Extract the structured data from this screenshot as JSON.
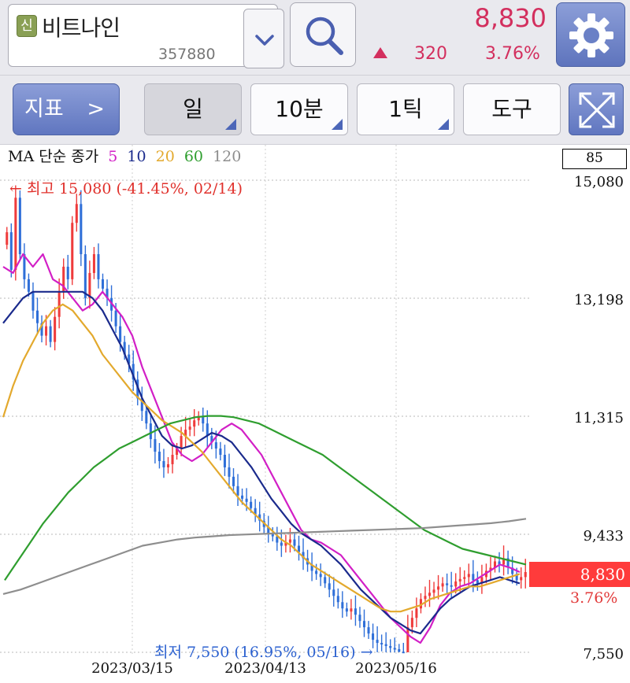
{
  "header": {
    "badge": "신",
    "stock_name": "비트나인",
    "stock_code": "357880",
    "price": "8,830",
    "change": "320",
    "change_pct": "3.76%",
    "up_color": "#d32f5e",
    "icons": {
      "dropdown": "chevron-down-icon",
      "search": "search-icon",
      "settings": "gear-icon"
    }
  },
  "toolbar": {
    "indicator_label": "지표",
    "indicator_arrow": ">",
    "period_day": "일",
    "period_minute": "10분",
    "period_tick": "1틱",
    "tools": "도구",
    "expand_icon": "expand-icon"
  },
  "chart": {
    "legend": {
      "title": "MA 단순 종가",
      "periods": [
        {
          "label": "5",
          "color": "#d21fc6"
        },
        {
          "label": "10",
          "color": "#1a2a8c"
        },
        {
          "label": "20",
          "color": "#e3a92d"
        },
        {
          "label": "60",
          "color": "#2f9e2f"
        },
        {
          "label": "120",
          "color": "#8e8e8e"
        }
      ]
    },
    "top_box_value": "85",
    "high_annotation": "← 최고 15,080 (-41.45%, 02/14)",
    "low_annotation": "최저 7,550 (16.95%, 05/16) →",
    "current_price_tag": "8,830",
    "current_pct_tag": "3.76%",
    "up_color": "#ef3b3b",
    "down_color": "#2f6fd8"
  },
  "chart_data": {
    "type": "candlestick",
    "ylim": [
      7550,
      15080
    ],
    "y_ticks": [
      "15,080",
      "13,198",
      "11,315",
      "9,433",
      "7,550"
    ],
    "x_ticks": [
      "2023/03/15",
      "2023/04/13",
      "2023/05/16"
    ],
    "high": {
      "value": 15080,
      "pct": "-41.45%",
      "date": "02/14"
    },
    "low": {
      "value": 7550,
      "pct": "16.95%",
      "date": "05/16"
    },
    "last_close": 8830,
    "closes": [
      14250,
      13650,
      14800,
      13900,
      13500,
      13300,
      13000,
      12800,
      12600,
      12750,
      12500,
      12900,
      13300,
      13700,
      13500,
      14400,
      14700,
      13900,
      13200,
      13600,
      13900,
      13500,
      13350,
      13200,
      13000,
      12750,
      12500,
      12300,
      12150,
      11900,
      11600,
      11400,
      11200,
      10950,
      10750,
      10600,
      10500,
      10550,
      10700,
      10800,
      11000,
      11100,
      11150,
      11250,
      11300,
      11200,
      11000,
      10900,
      10800,
      10700,
      10500,
      10350,
      10200,
      10050,
      10000,
      9950,
      9850,
      9750,
      9650,
      9550,
      9450,
      9400,
      9300,
      9250,
      9300,
      9350,
      9250,
      9150,
      9050,
      8950,
      8850,
      8800,
      8750,
      8650,
      8550,
      8450,
      8350,
      8250,
      8200,
      8250,
      8150,
      8050,
      7950,
      7850,
      7750,
      7700,
      7680,
      7650,
      7620,
      7600,
      7560,
      7550,
      7950,
      8100,
      8250,
      8400,
      8450,
      8500,
      8550,
      8600,
      8650,
      8620,
      8600,
      8680,
      8720,
      8750,
      8800,
      8700,
      8650,
      8750,
      8850,
      8900,
      9000,
      8950,
      9050,
      8900,
      8800,
      8700,
      8750,
      8830
    ],
    "ma_series": [
      {
        "name": "5",
        "color": "#d21fc6",
        "values": [
          13700,
          13600,
          13900,
          13700,
          13900,
          13500,
          13400,
          13200,
          13000,
          13100,
          13300,
          13100,
          12900,
          12600,
          12100,
          11700,
          11300,
          10900,
          10700,
          10600,
          10700,
          10900,
          11100,
          11200,
          11100,
          10900,
          10700,
          10400,
          10100,
          9800,
          9500,
          9350,
          9300,
          9200,
          9100,
          8900,
          8700,
          8500,
          8300,
          8100,
          7950,
          7800,
          7700,
          7950,
          8300,
          8500,
          8600,
          8650,
          8750,
          8850,
          8950,
          8900,
          8830
        ]
      },
      {
        "name": "10",
        "color": "#1a2a8c",
        "values": [
          12800,
          13000,
          13200,
          13300,
          13300,
          13300,
          13300,
          13300,
          13300,
          13200,
          13000,
          12700,
          12400,
          12000,
          11600,
          11300,
          11000,
          10850,
          10800,
          10850,
          10950,
          11050,
          11000,
          10900,
          10700,
          10500,
          10250,
          10000,
          9800,
          9600,
          9450,
          9350,
          9250,
          9100,
          8950,
          8750,
          8550,
          8400,
          8250,
          8100,
          8000,
          7900,
          7850,
          8050,
          8250,
          8400,
          8500,
          8600,
          8650,
          8700,
          8750,
          8700,
          8650
        ]
      },
      {
        "name": "20",
        "color": "#e3a92d",
        "values": [
          11300,
          11800,
          12200,
          12500,
          12800,
          13000,
          13100,
          13000,
          12800,
          12600,
          12300,
          12100,
          11900,
          11700,
          11550,
          11400,
          11250,
          11150,
          11050,
          10900,
          10750,
          10550,
          10350,
          10150,
          9950,
          9800,
          9650,
          9500,
          9350,
          9250,
          9100,
          8950,
          8850,
          8750,
          8650,
          8550,
          8450,
          8350,
          8250,
          8200,
          8200,
          8250,
          8300,
          8400,
          8450,
          8500,
          8550,
          8600,
          8600,
          8650,
          8700,
          8750,
          8800
        ]
      },
      {
        "name": "60",
        "color": "#2f9e2f",
        "values": [
          8700,
          9000,
          9300,
          9600,
          9850,
          10100,
          10300,
          10500,
          10650,
          10800,
          10900,
          11000,
          11100,
          11200,
          11250,
          11300,
          11320,
          11320,
          11300,
          11250,
          11200,
          11100,
          11000,
          10900,
          10800,
          10700,
          10550,
          10400,
          10250,
          10100,
          9950,
          9800,
          9650,
          9500,
          9400,
          9300,
          9200,
          9150,
          9100,
          9050,
          9000,
          8950
        ]
      },
      {
        "name": "120",
        "color": "#8e8e8e",
        "values": [
          8480,
          8550,
          8650,
          8750,
          8850,
          8950,
          9050,
          9150,
          9250,
          9300,
          9350,
          9380,
          9400,
          9420,
          9430,
          9440,
          9450,
          9460,
          9470,
          9480,
          9490,
          9500,
          9510,
          9520,
          9530,
          9550,
          9570,
          9590,
          9610,
          9640,
          9680
        ]
      }
    ]
  }
}
